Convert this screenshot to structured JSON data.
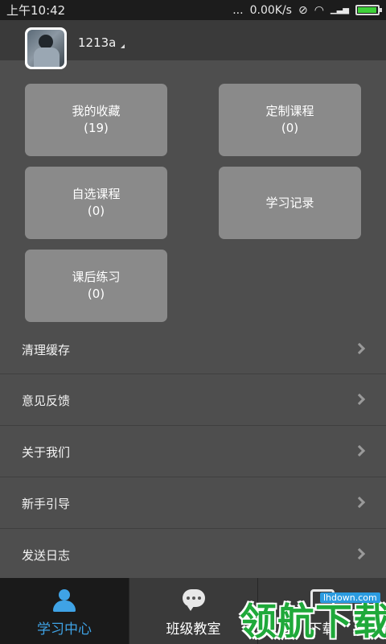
{
  "status_bar": {
    "time": "上午10:42",
    "dots": "...",
    "speed": "0.00K/s",
    "icons": [
      "alarm-off-icon",
      "wifi-icon",
      "signal-icon",
      "battery-icon"
    ],
    "battery_level": 0.9
  },
  "header": {
    "username": "1213a"
  },
  "tiles": [
    {
      "label": "我的收藏",
      "count": "(19)"
    },
    {
      "label": "定制课程",
      "count": "(0)"
    },
    {
      "label": "自选课程",
      "count": "(0)"
    },
    {
      "label": "学习记录",
      "count": ""
    },
    {
      "label": "课后练习",
      "count": "(0)"
    }
  ],
  "menu": [
    {
      "label": "清理缓存"
    },
    {
      "label": "意见反馈"
    },
    {
      "label": "关于我们"
    },
    {
      "label": "新手引导"
    },
    {
      "label": "发送日志"
    }
  ],
  "bottom_nav": [
    {
      "label": "学习中心",
      "icon": "person-icon",
      "active": true
    },
    {
      "label": "班级教室",
      "icon": "chat-icon",
      "active": false
    },
    {
      "label": "下载",
      "icon": "download-icon",
      "active": false
    }
  ],
  "watermark": {
    "text": "领航下载",
    "site": "lhdown.com"
  },
  "colors": {
    "accent": "#3fa3e6",
    "background": "#4e4e4e",
    "tile": "#8a8a8a",
    "watermark": "#1fa93a"
  }
}
